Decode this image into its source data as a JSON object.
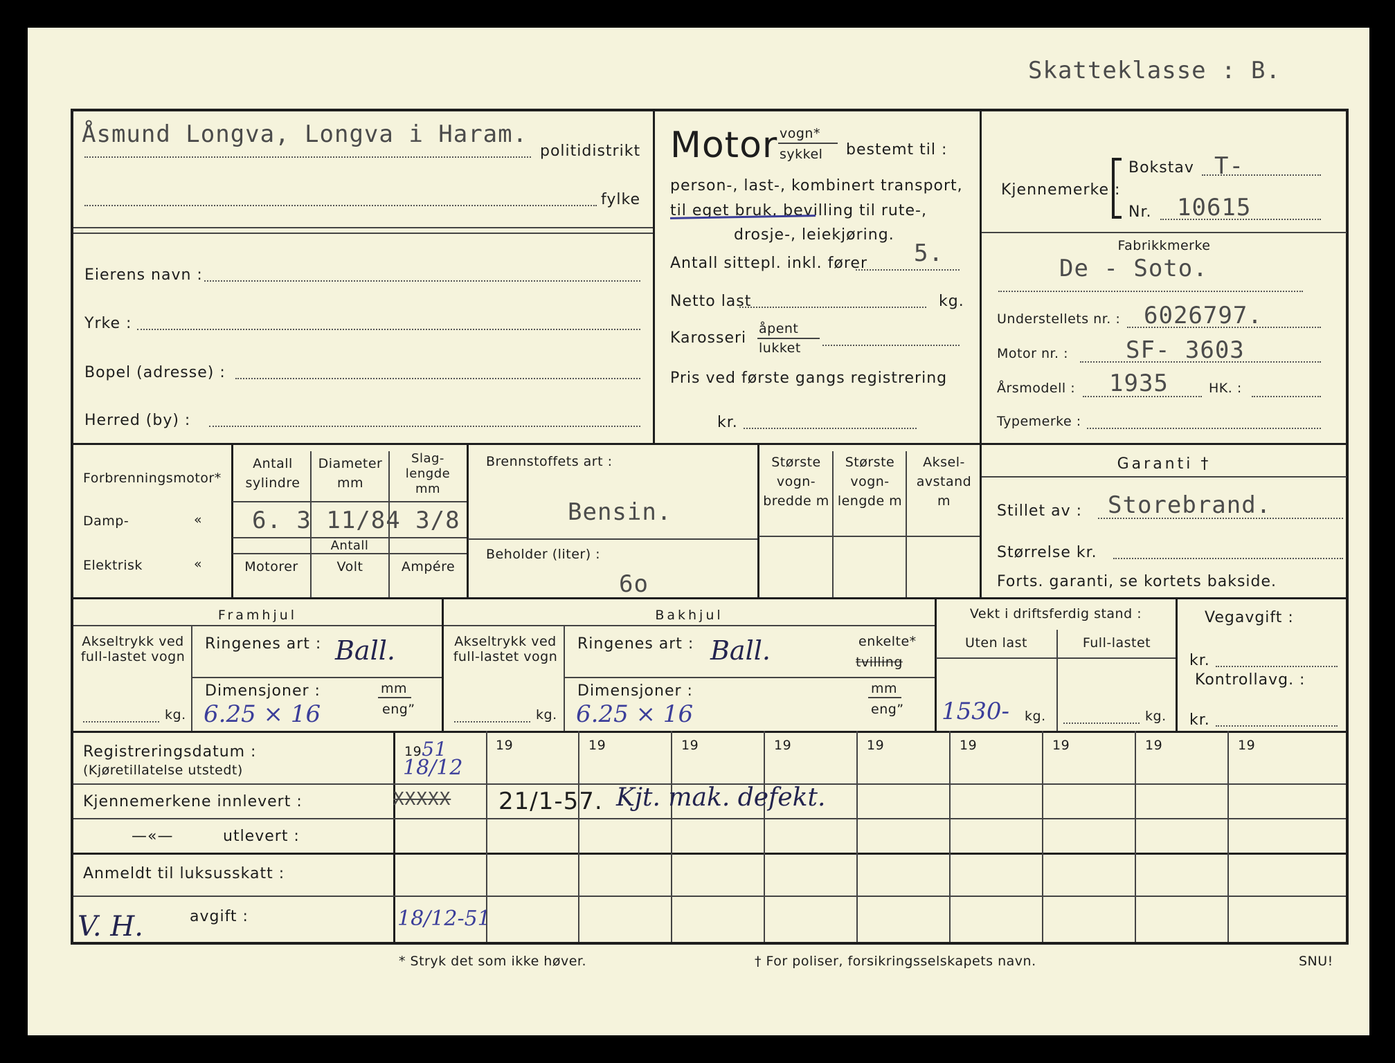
{
  "header": {
    "tax_class": "Skatteklasse : B."
  },
  "owner_area": {
    "typed_owner_line": "Åsmund Longva, Longva i Haram.",
    "politidistrikt_label": "politidistrikt",
    "fylke_label": "fylke",
    "eierens_navn_label": "Eierens navn :",
    "yrke_label": "Yrke :",
    "bopel_label": "Bopel (adresse) :",
    "herred_label": "Herred (by) :"
  },
  "motor_block": {
    "title": "Motor",
    "vogn": "vogn*",
    "sykkel": "sykkel",
    "bestemt": "bestemt til :",
    "line1": "person-, last-, kombinert transport,",
    "line2": "til eget bruk, bevilling til rute-,",
    "line3": "drosje-, leiekjøring.",
    "antall_label": "Antall sittepl. inkl. fører",
    "antall_value": "5.",
    "netto_label": "Netto last",
    "netto_unit": "kg.",
    "karosseri_label": "Karosseri",
    "apent": "åpent",
    "lukket": "lukket",
    "pris_label": "Pris ved første gangs registrering",
    "kr_label": "kr."
  },
  "id_block": {
    "kjennemerke_label": "Kjennemerke :",
    "bokstav_label": "Bokstav",
    "bokstav_value": "T-",
    "nr_label": "Nr.",
    "nr_value": "10615",
    "fabrikkmerke_label": "Fabrikkmerke",
    "fabrikkmerke_value": "De - Soto.",
    "understell_label": "Understellets nr. :",
    "understell_value": "6026797.",
    "motor_nr_label": "Motor nr. :",
    "motor_nr_value": "SF- 3603",
    "arsmodell_label": "Årsmodell :",
    "arsmodell_value": "1935",
    "hk_label": "HK. :",
    "typemerke_label": "Typemerke :"
  },
  "engine": {
    "forbrenning": "Forbrenningsmotor*",
    "damp": "Damp-",
    "elektrisk": "Elektrisk",
    "ditto": "«",
    "antall_sylindre": "Antall sylindre",
    "diameter": "Diameter mm",
    "slaglengde": "Slag- lengde mm",
    "typed_values": "6. 3 11/84 3/8",
    "antall": "Antall",
    "motorer": "Motorer",
    "volt": "Volt",
    "ampere": "Ampére",
    "brennstoff_label": "Brennstoffets art :",
    "brennstoff_value": "Bensin.",
    "beholder_label": "Beholder (liter) :",
    "beholder_value": "6o",
    "storste_bredde": "Største vogn- bredde m",
    "storste_lengde": "Største vogn- lengde m",
    "akselavstand": "Aksel- avstand m"
  },
  "garanti": {
    "title": "Garanti †",
    "stillet_label": "Stillet av :",
    "stillet_value": "Storebrand.",
    "storrelse_label": "Størrelse kr.",
    "forts_label": "Forts. garanti, se kortets bakside."
  },
  "wheels": {
    "framhjul": "Framhjul",
    "bakhjul": "Bakhjul",
    "akseltrykk": "Akseltrykk ved full-lastet vogn",
    "kg": "kg.",
    "ringenes_label": "Ringenes art :",
    "ringenes_front": "Ball.",
    "ringenes_rear": "Ball.",
    "enkelte": "enkelte*",
    "tvilling": "tvilling",
    "dimensjoner_label": "Dimensjoner :",
    "dim_front": "6.25 × 16",
    "dim_rear": "6.25 × 16",
    "mm": "mm",
    "eng": "eng”"
  },
  "weight": {
    "title": "Vekt i driftsferdig stand :",
    "uten": "Uten last",
    "full": "Full-lastet",
    "uten_value": "1530-",
    "kg": "kg."
  },
  "vegavgift": {
    "label": "Vegavgift :",
    "kr": "kr.",
    "kontroll": "Kontrollavg. :"
  },
  "registration": {
    "reg_label": "Registreringsdatum :",
    "reg_sub": "(Kjøretillatelse utstedt)",
    "year_prefix": "19",
    "first_year": "51",
    "first_date": "18/12",
    "innlevert_label": "Kjennemerkene innlevert :",
    "innlevert_struck": "XXXXX",
    "innlevert_value": "21/1-57.",
    "innlevert_note": "Kjt. mak. defekt.",
    "utlevert_dash": "—«—",
    "utlevert_label": "utlevert :",
    "luksus_label": "Anmeldt til luksusskatt :",
    "avgift_label": "avgift :",
    "vh_mark": "V. H.",
    "luksus_date": "18/12-51"
  },
  "footer": {
    "note1": "* Stryk det som ikke høver.",
    "note2": "† For poliser, forsikringsselskapets navn.",
    "printer": "SNU!"
  }
}
